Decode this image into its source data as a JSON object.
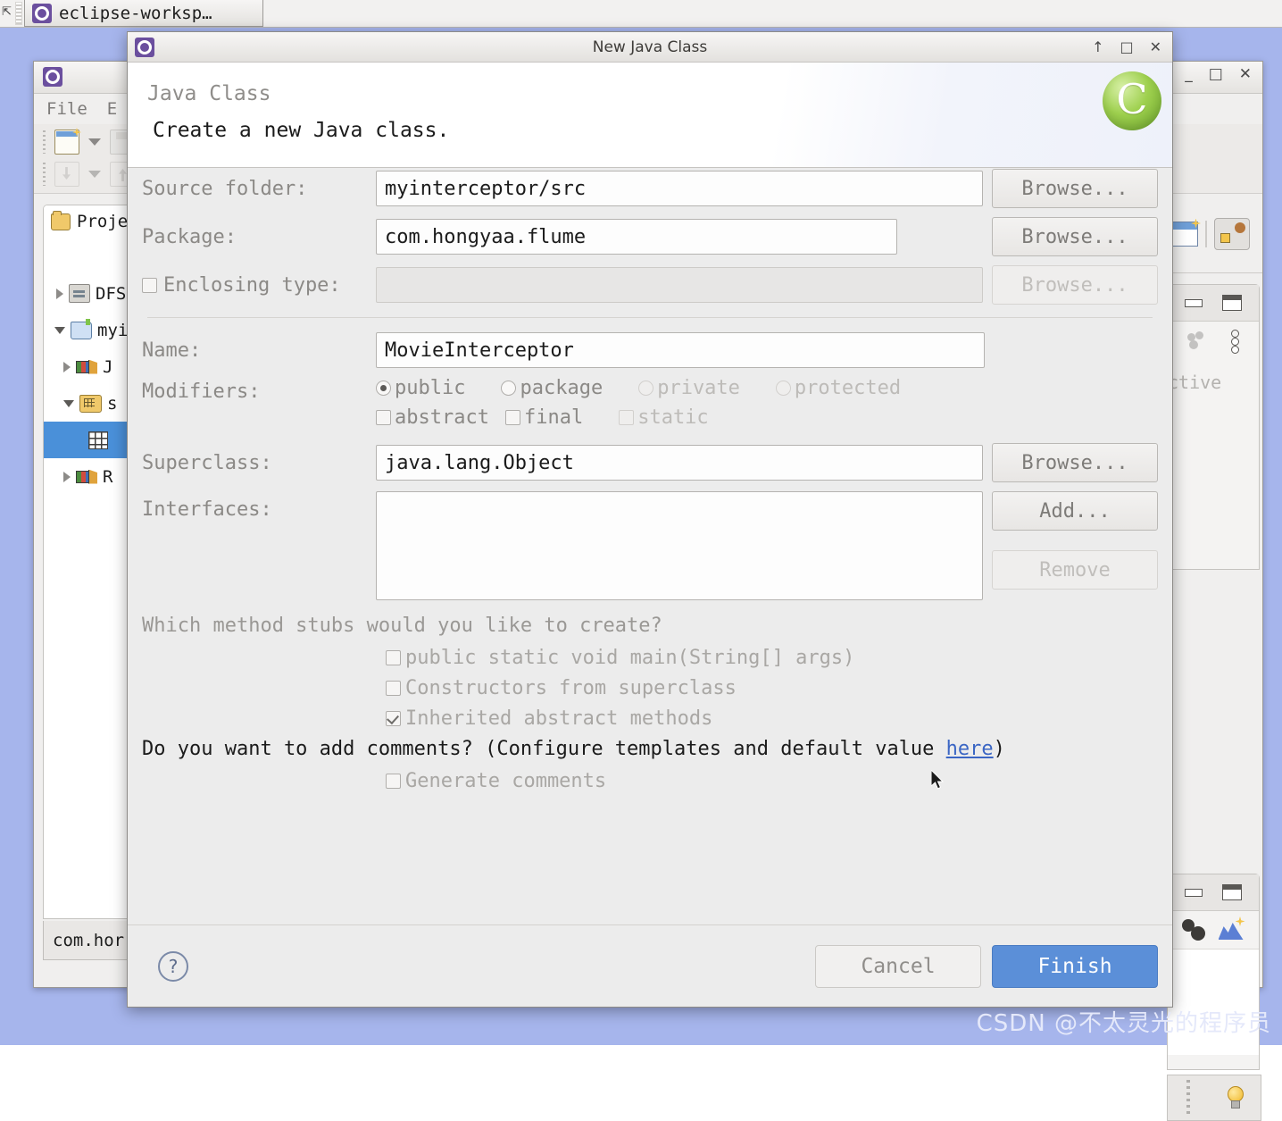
{
  "taskbar": {
    "window_label": "eclipse-worksp…",
    "app_icon": "eclipse-icon"
  },
  "eclipse_window": {
    "menus": [
      "File",
      "E"
    ],
    "window_controls": {
      "minimize": "_",
      "maximize": "□",
      "close": "✕"
    },
    "project_panel": {
      "title": "Proje",
      "tree": [
        {
          "label": "DFS",
          "icon": "dfs-icon",
          "expanded": false,
          "indent": 0,
          "selected": false
        },
        {
          "label": "myi",
          "icon": "project-open-icon",
          "expanded": true,
          "indent": 0,
          "selected": false
        },
        {
          "label": "J",
          "icon": "library-icon",
          "expanded": false,
          "indent": 1,
          "selected": false
        },
        {
          "label": "s",
          "icon": "source-folder-icon",
          "expanded": true,
          "indent": 1,
          "selected": false
        },
        {
          "label": "",
          "icon": "package-icon",
          "expanded": null,
          "indent": 2,
          "selected": true
        },
        {
          "label": "R",
          "icon": "library-icon",
          "expanded": false,
          "indent": 1,
          "selected": false
        }
      ]
    },
    "status_tab": "com.hor",
    "right_dock": {
      "perspective_buttons": [
        "open-perspective-icon",
        "java-ee-perspective-icon"
      ],
      "outline_text": "ctive",
      "view_icons": [
        "servers-icon",
        "view-menu-icon",
        "gears-icon",
        "blue-mountain-icon",
        "lightbulb-icon"
      ]
    }
  },
  "dialog": {
    "title": "New Java Class",
    "title_icon": "eclipse-icon",
    "window_controls": {
      "restore": "↑",
      "maximize": "□",
      "close": "✕"
    },
    "header": {
      "title": "Java Class",
      "description": "Create a new Java class.",
      "icon": "java-class-green-c-icon",
      "icon_letter": "C"
    },
    "fields": {
      "source_folder": {
        "label": "Source folder:",
        "value": "myinterceptor/src",
        "button": "Browse..."
      },
      "package": {
        "label": "Package:",
        "value": "com.hongyaa.flume",
        "button": "Browse..."
      },
      "enclosing_type": {
        "label": "Enclosing type:",
        "value": "",
        "button": "Browse...",
        "checked": false,
        "disabled": true
      },
      "name": {
        "label": "Name:",
        "value": "MovieInterceptor"
      },
      "superclass": {
        "label": "Superclass:",
        "value": "java.lang.Object",
        "button": "Browse..."
      },
      "interfaces": {
        "label": "Interfaces:",
        "value": "",
        "add_button": "Add...",
        "remove_button": "Remove"
      }
    },
    "modifiers": {
      "label": "Modifiers:",
      "access": [
        {
          "label": "public",
          "selected": true,
          "disabled": false
        },
        {
          "label": "package",
          "selected": false,
          "disabled": false
        },
        {
          "label": "private",
          "selected": false,
          "disabled": true
        },
        {
          "label": "protected",
          "selected": false,
          "disabled": true
        }
      ],
      "extra": [
        {
          "label": "abstract",
          "checked": false,
          "disabled": false
        },
        {
          "label": "final",
          "checked": false,
          "disabled": false
        },
        {
          "label": "static",
          "checked": false,
          "disabled": true
        }
      ]
    },
    "stubs": {
      "question": "Which method stubs would you like to create?",
      "options": [
        {
          "label": "public static void main(String[] args)",
          "checked": false
        },
        {
          "label": "Constructors from superclass",
          "checked": false
        },
        {
          "label": "Inherited abstract methods",
          "checked": true
        }
      ]
    },
    "comments": {
      "question_prefix": "Do you want to add comments? (Configure templates and default value ",
      "link": "here",
      "question_suffix": ")",
      "option": {
        "label": "Generate comments",
        "checked": false
      }
    },
    "footer": {
      "help_icon": "question-mark-icon",
      "cancel": "Cancel",
      "finish": "Finish"
    }
  },
  "watermark": "CSDN @不太灵光的程序员",
  "colors": {
    "desktop": "#a6b5ec",
    "dialog_bg": "#ececec",
    "finish_button": "#5b8fd8",
    "selection": "#4a90d9",
    "link": "#3b66c4"
  }
}
